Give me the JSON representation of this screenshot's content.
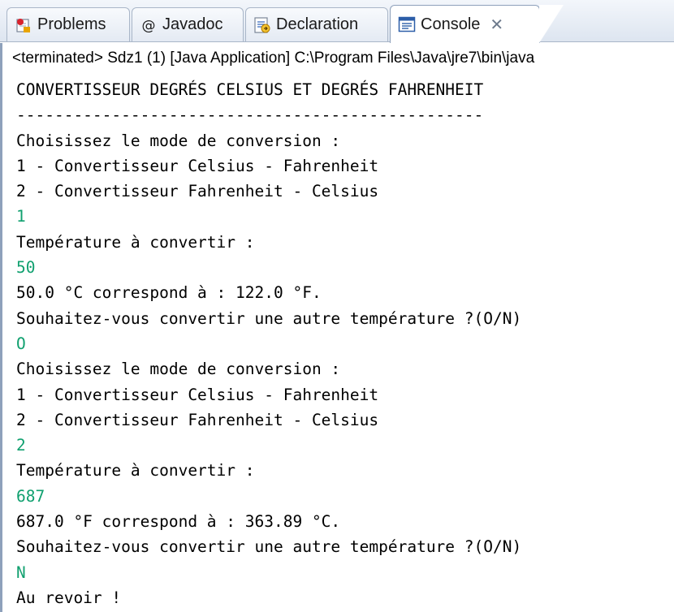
{
  "tabs": [
    {
      "label": "Problems",
      "icon": "problems-icon"
    },
    {
      "label": "Javadoc",
      "icon": "at-sign-icon"
    },
    {
      "label": "Declaration",
      "icon": "declaration-icon"
    },
    {
      "label": "Console",
      "icon": "console-icon",
      "active": true
    }
  ],
  "close_glyph": "✕",
  "status_line": "<terminated> Sdz1 (1) [Java Application] C:\\Program Files\\Java\\jre7\\bin\\java",
  "colors": {
    "input_text": "#10a06f",
    "output_text": "#000000",
    "tab_border": "#a9b6c8"
  },
  "console_lines": [
    {
      "text": "CONVERTISSEUR DEGRÉS CELSIUS ET DEGRÉS FAHRENHEIT",
      "type": "output"
    },
    {
      "text": "-------------------------------------------------",
      "type": "output"
    },
    {
      "text": "Choisissez le mode de conversion :",
      "type": "output"
    },
    {
      "text": "1 - Convertisseur Celsius - Fahrenheit",
      "type": "output"
    },
    {
      "text": "2 - Convertisseur Fahrenheit - Celsius",
      "type": "output"
    },
    {
      "text": "1",
      "type": "input"
    },
    {
      "text": "Température à convertir :",
      "type": "output"
    },
    {
      "text": "50",
      "type": "input"
    },
    {
      "text": "50.0 °C correspond à : 122.0 °F.",
      "type": "output"
    },
    {
      "text": "Souhaitez-vous convertir une autre température ?(O/N)",
      "type": "output"
    },
    {
      "text": "O",
      "type": "input"
    },
    {
      "text": "Choisissez le mode de conversion :",
      "type": "output"
    },
    {
      "text": "1 - Convertisseur Celsius - Fahrenheit",
      "type": "output"
    },
    {
      "text": "2 - Convertisseur Fahrenheit - Celsius",
      "type": "output"
    },
    {
      "text": "2",
      "type": "input"
    },
    {
      "text": "Température à convertir :",
      "type": "output"
    },
    {
      "text": "687",
      "type": "input"
    },
    {
      "text": "687.0 °F correspond à : 363.89 °C.",
      "type": "output"
    },
    {
      "text": "Souhaitez-vous convertir une autre température ?(O/N)",
      "type": "output"
    },
    {
      "text": "N",
      "type": "input"
    },
    {
      "text": "Au revoir !",
      "type": "output"
    }
  ]
}
